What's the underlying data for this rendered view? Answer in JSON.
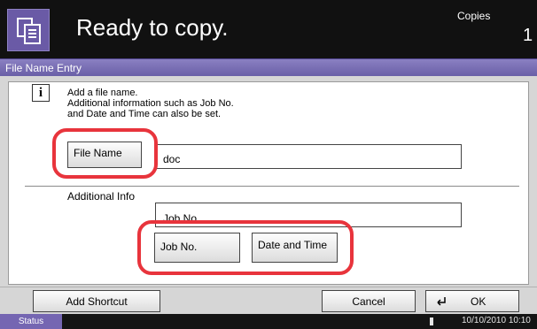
{
  "header": {
    "title": "Ready to copy.",
    "copies_label": "Copies",
    "copies_value": "1",
    "icon": "copy-document-icon"
  },
  "panel": {
    "title": "File Name Entry",
    "info_icon": "i",
    "info_lines": [
      "Add a file name.",
      "Additional information such as Job No.",
      "and Date and Time can also be set."
    ],
    "file_name_button": "File Name",
    "file_name_value": "doc",
    "additional_info_label": "Additional Info",
    "additional_info_value": "Job No.",
    "job_no_button": "Job No.",
    "date_time_button": "Date and Time"
  },
  "bottom": {
    "add_shortcut": "Add Shortcut",
    "cancel": "Cancel",
    "ok": "OK"
  },
  "status": {
    "button": "Status",
    "datetime": "10/10/2010  10:10"
  },
  "colors": {
    "accent": "#7566b2",
    "highlight": "#e8343c",
    "header_bg": "#111111"
  }
}
